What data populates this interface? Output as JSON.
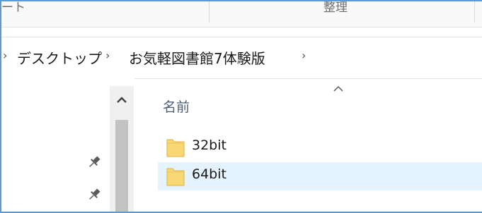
{
  "ribbon": {
    "left_group_label": "ート",
    "right_group_label": "整理"
  },
  "address_bar": {
    "crumbs": [
      "デスクトップ",
      "お気軽図書館7体験版"
    ]
  },
  "navigation_pane": {
    "pinned_items": 2
  },
  "file_list": {
    "column_name": "名前",
    "sort": "ascending",
    "items": [
      {
        "name": "32bit",
        "type": "folder",
        "selected": false
      },
      {
        "name": "64bit",
        "type": "folder",
        "selected": true
      }
    ]
  },
  "colors": {
    "window_border": "#5b9bd5",
    "selection": "#e5f3ff",
    "folder_fill": "#f8d775",
    "header_text": "#4c607a"
  }
}
